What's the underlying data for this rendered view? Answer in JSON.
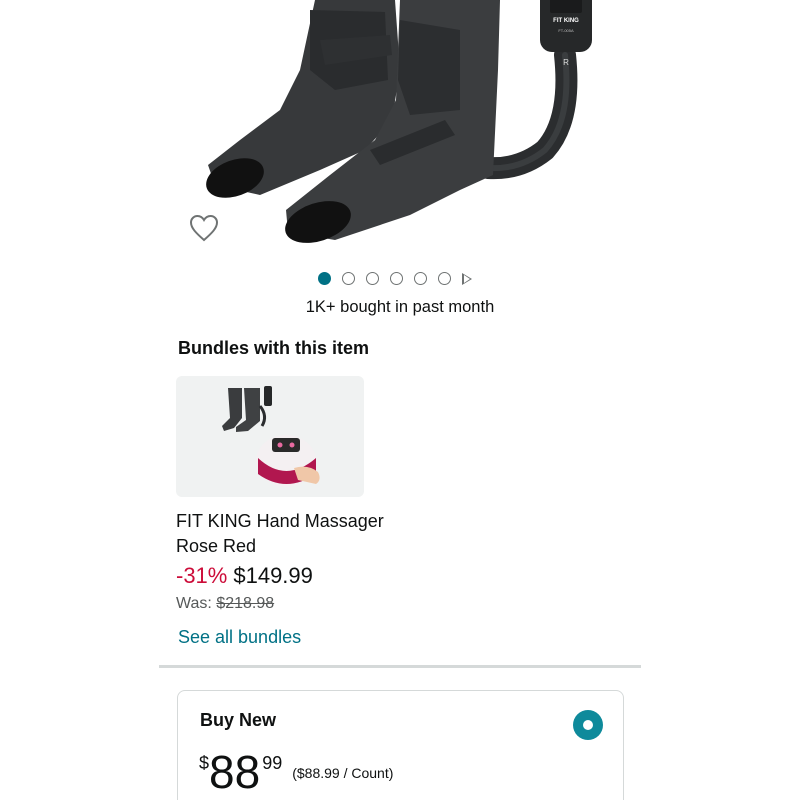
{
  "product": {
    "device_brand": "FIT KING",
    "device_model": "FT-005A",
    "device_side": "R"
  },
  "gallery": {
    "image_count": 6,
    "active_index": 0
  },
  "social_proof": "1K+ bought in past month",
  "bundles": {
    "title": "Bundles with this item",
    "item_name": "FIT KING Hand Massager Rose Red",
    "discount": "-31%",
    "price": "$149.99",
    "was_label": "Was:",
    "was_price": "$218.98",
    "see_all": "See all bundles"
  },
  "buy_box": {
    "title": "Buy New",
    "currency": "$",
    "price_whole": "88",
    "price_fraction": "99",
    "unit_price": "($88.99 / Count)",
    "selected": true
  },
  "colors": {
    "link": "#007185",
    "discount": "#cc0c39",
    "radio": "#0e8a9b"
  },
  "icons": [
    "heart-icon",
    "play-icon",
    "radio-selected-icon"
  ]
}
